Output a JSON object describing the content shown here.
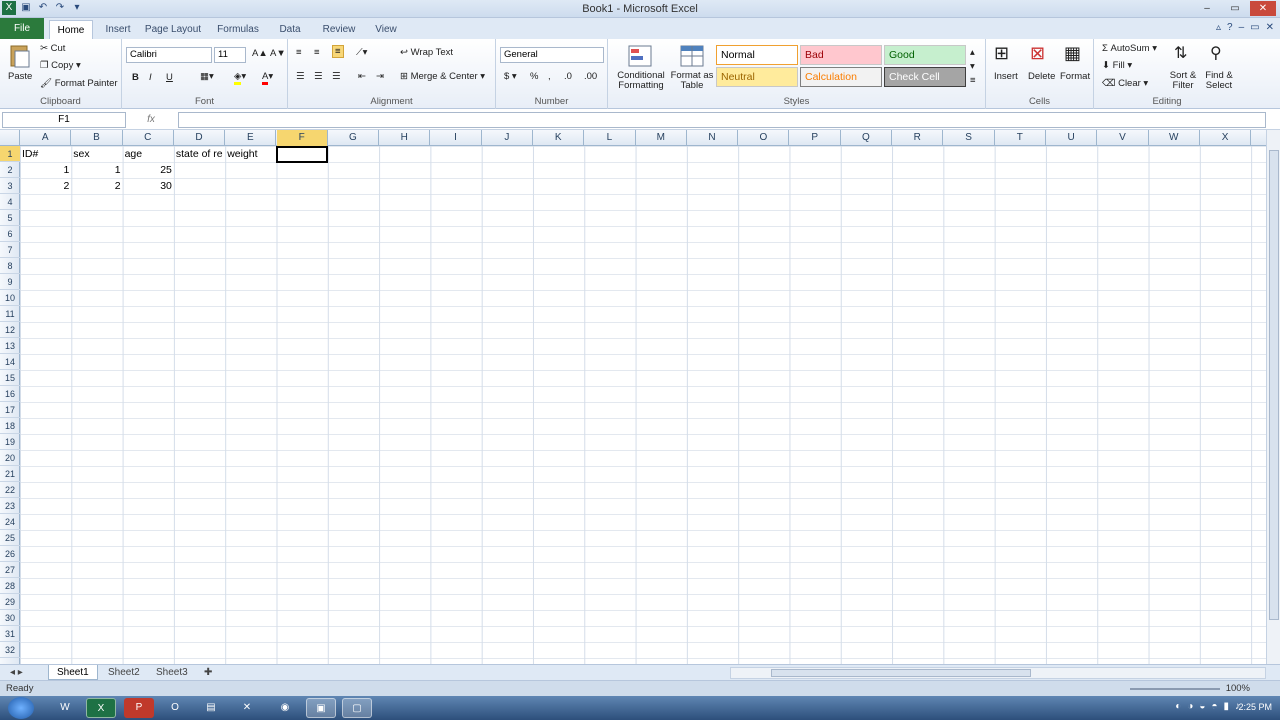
{
  "window": {
    "title": "Book1 - Microsoft Excel"
  },
  "tabs": [
    "File",
    "Home",
    "Insert",
    "Page Layout",
    "Formulas",
    "Data",
    "Review",
    "View"
  ],
  "ribbon": {
    "clipboard": {
      "label": "Clipboard",
      "paste": "Paste",
      "cut": "Cut",
      "copy": "Copy",
      "format_painter": "Format Painter"
    },
    "font": {
      "label": "Font",
      "font_name": "Calibri",
      "font_size": "11",
      "bold": "B",
      "italic": "I",
      "underline": "U"
    },
    "alignment": {
      "label": "Alignment",
      "wrap_text": "Wrap Text",
      "merge_center": "Merge & Center"
    },
    "number": {
      "label": "Number",
      "format": "General",
      "currency": "$",
      "percent": "%"
    },
    "styles": {
      "label": "Styles",
      "conditional_formatting": "Conditional Formatting",
      "format_as_table": "Format as Table",
      "cells": [
        {
          "name": "Normal",
          "bg": "#ffffff",
          "fg": "#000000",
          "border": "#f0a030"
        },
        {
          "name": "Bad",
          "bg": "#ffc7ce",
          "fg": "#9c0006"
        },
        {
          "name": "Good",
          "bg": "#c6efce",
          "fg": "#006100"
        },
        {
          "name": "Neutral",
          "bg": "#ffeb9c",
          "fg": "#9c6500"
        },
        {
          "name": "Calculation",
          "bg": "#f2f2f2",
          "fg": "#fa7d00",
          "border": "#7f7f7f"
        },
        {
          "name": "Check Cell",
          "bg": "#a5a5a5",
          "fg": "#ffffff",
          "border": "#3f3f3f"
        }
      ]
    },
    "cells": {
      "label": "Cells",
      "insert": "Insert",
      "delete": "Delete",
      "format": "Format"
    },
    "editing": {
      "label": "Editing",
      "autosum": "AutoSum",
      "fill": "Fill",
      "clear": "Clear",
      "sort_filter": "Sort & Filter",
      "find_select": "Find & Select"
    }
  },
  "formula_bar": {
    "name_box": "F1",
    "fx": "fx",
    "value": ""
  },
  "columns": [
    "A",
    "B",
    "C",
    "D",
    "E",
    "F",
    "G",
    "H",
    "I",
    "J",
    "K",
    "L",
    "M",
    "N",
    "O",
    "P",
    "Q",
    "R",
    "S",
    "T",
    "U",
    "V",
    "W",
    "X"
  ],
  "active_column": "F",
  "rows": [
    "1",
    "2",
    "3",
    "4",
    "5",
    "6",
    "7",
    "8",
    "9",
    "10",
    "11",
    "12",
    "13",
    "14",
    "15",
    "16",
    "17",
    "18",
    "19",
    "20",
    "21",
    "22",
    "23",
    "24",
    "25",
    "26",
    "27",
    "28",
    "29",
    "30",
    "31",
    "32"
  ],
  "cells": {
    "A1": "ID#",
    "B1": "sex",
    "C1": "age",
    "D1": "state of re",
    "E1": "weight",
    "A2": "1",
    "B2": "1",
    "C2": "25",
    "A3": "2",
    "B3": "2",
    "C3": "30"
  },
  "sheets": [
    "Sheet1",
    "Sheet2",
    "Sheet3"
  ],
  "status": {
    "ready": "Ready",
    "zoom": "100%"
  },
  "taskbar": {
    "time": "2:25 PM"
  }
}
